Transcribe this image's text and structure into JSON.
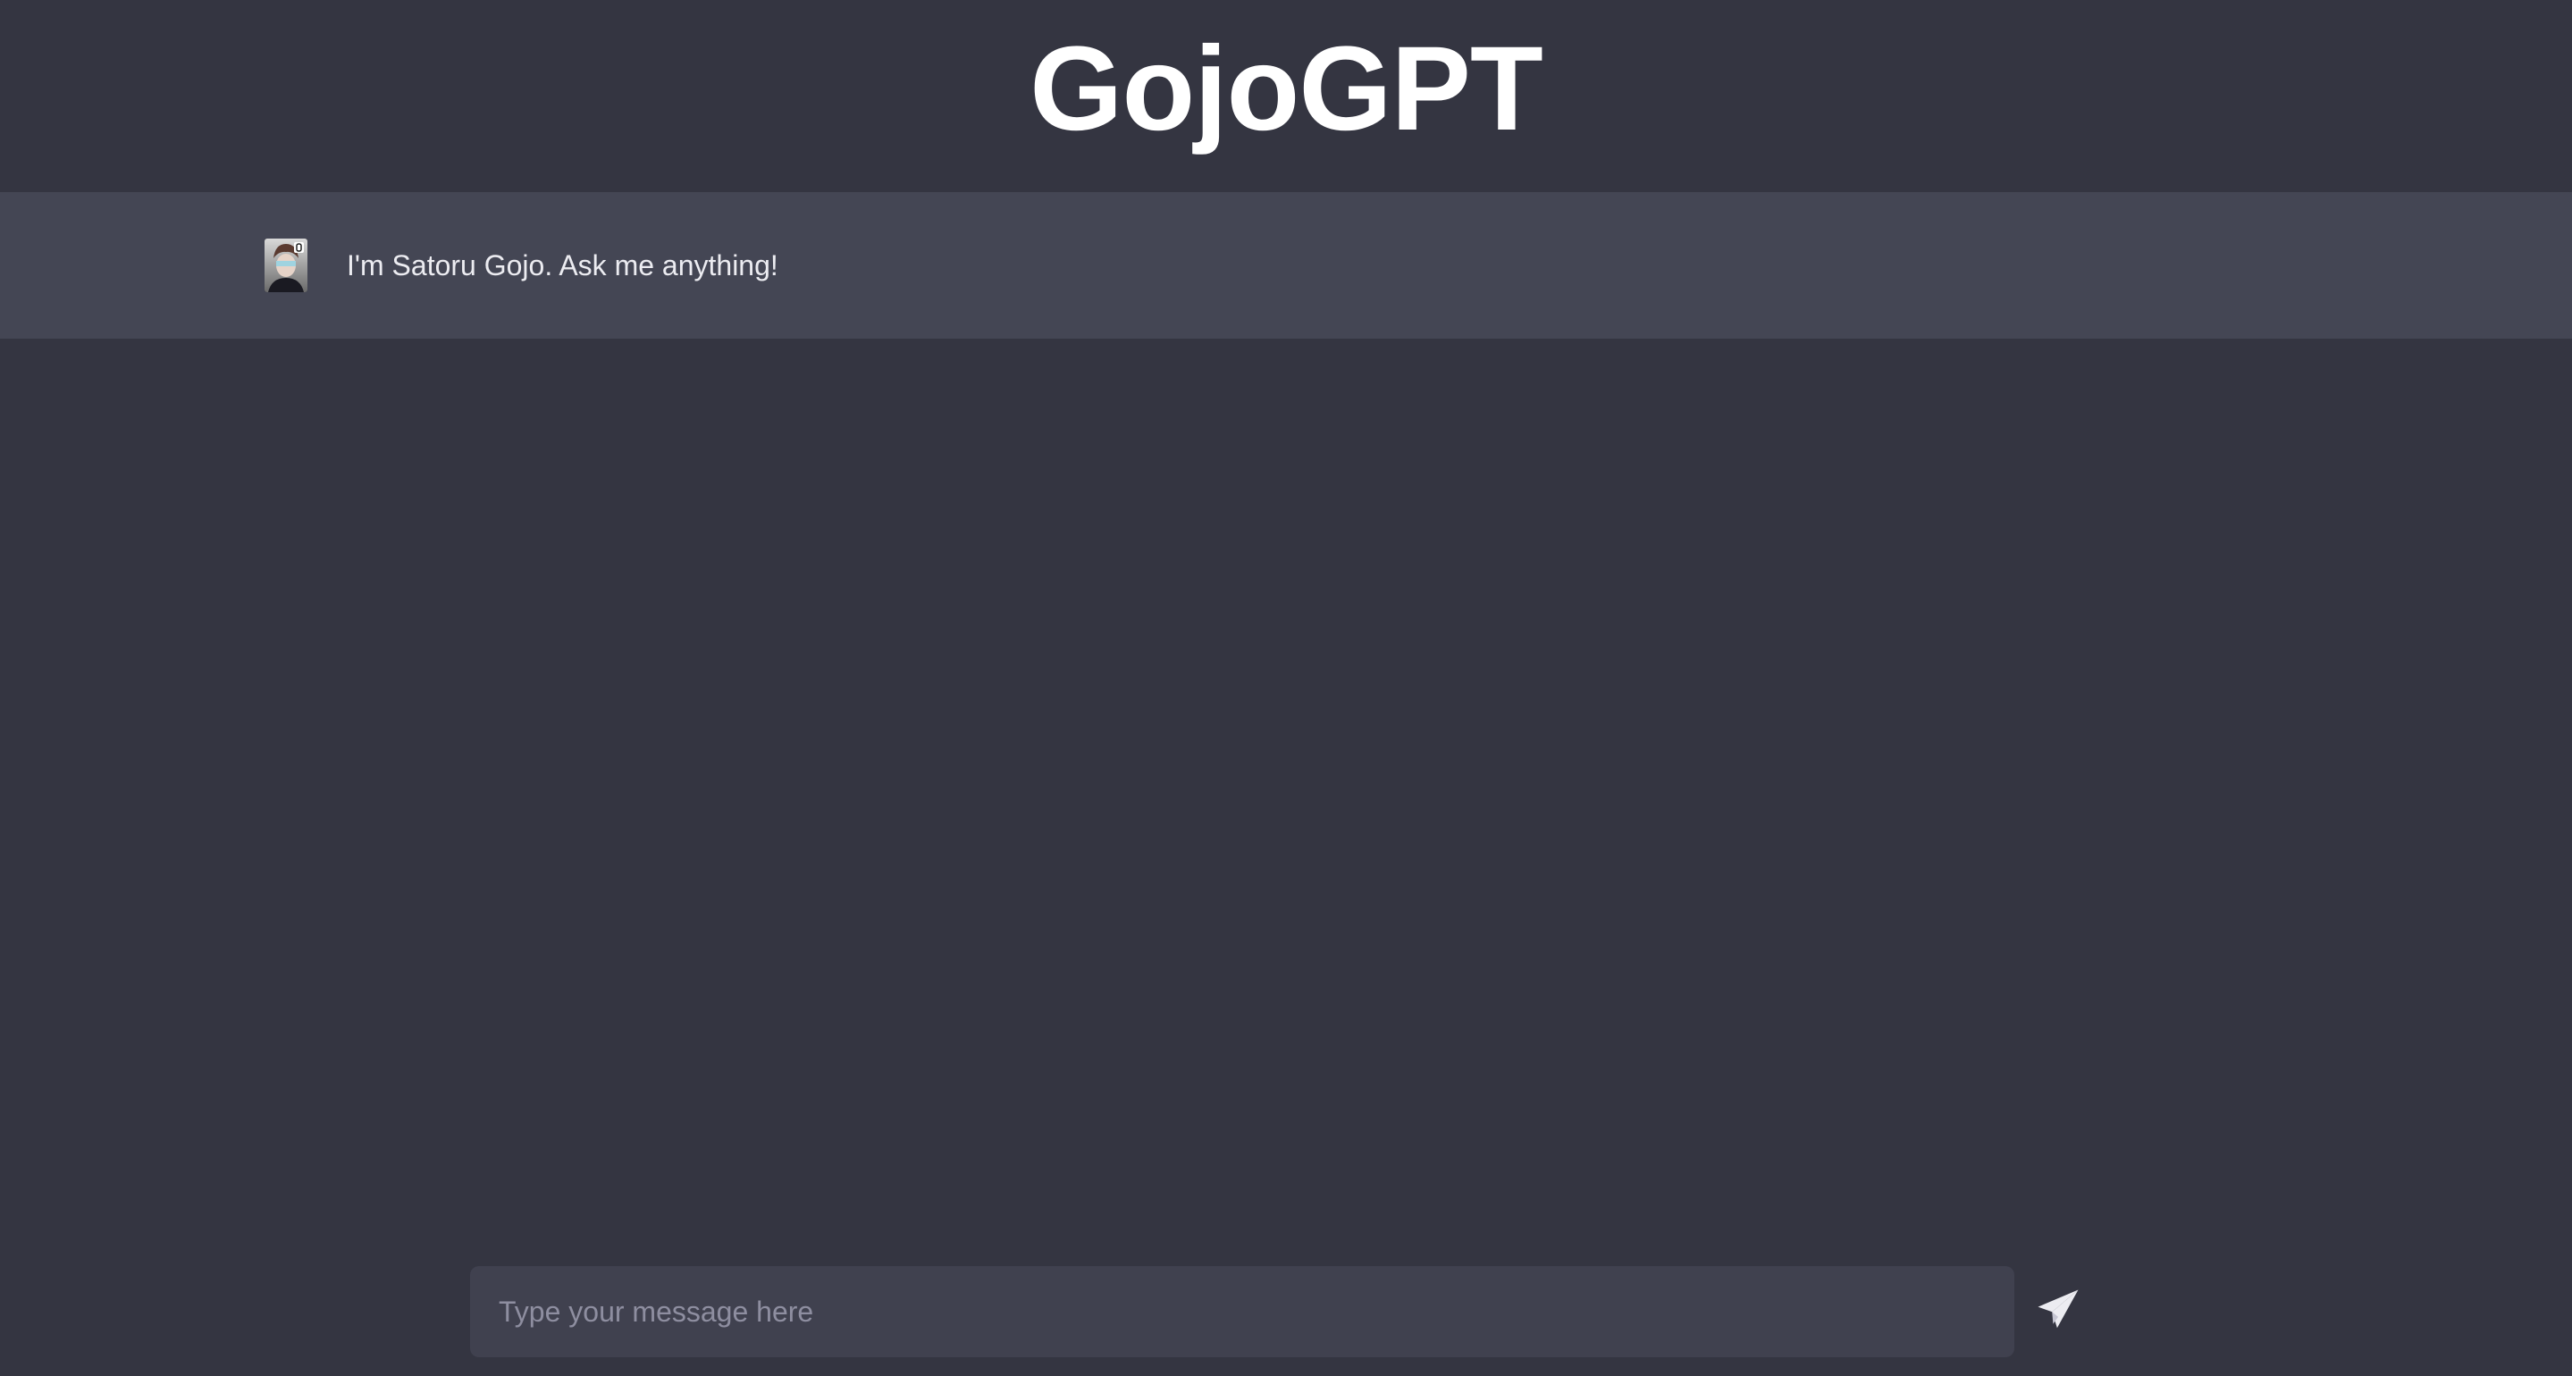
{
  "app": {
    "title": "GojoGPT"
  },
  "conversation": {
    "messages": [
      {
        "role": "assistant",
        "avatar": "gojo-avatar",
        "text": "I'm Satoru Gojo. Ask me anything!"
      }
    ]
  },
  "composer": {
    "value": "",
    "placeholder": "Type your message here",
    "send_icon": "paper-plane-icon"
  },
  "colors": {
    "background": "#343541",
    "assistant_row": "#444654",
    "input_background": "#40414f",
    "text": "#ececf1",
    "placeholder": "#8e8ea0"
  }
}
